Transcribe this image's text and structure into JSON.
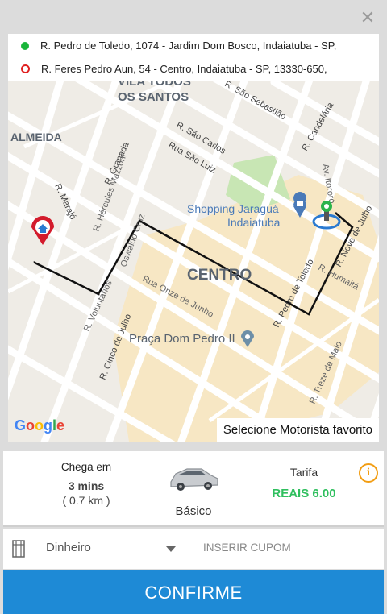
{
  "addresses": {
    "origin": "R. Pedro de Toledo, 1074 - Jardim Dom Bosco, Indaiatuba - SP,",
    "destination": "R. Feres Pedro Aun, 54 - Centro, Indaiatuba - SP, 13330-650,"
  },
  "map": {
    "labels": {
      "vila": "VILA TODOS",
      "santos": "OS SANTOS",
      "almeida": "ALMEIDA",
      "centro": "CENTRO",
      "shopping1": "Shopping Jaraguá",
      "shopping2": "Indaiatuba",
      "praca": "Praça Dom Pedro II",
      "r_sao_sebastiao": "R. São Sebastião",
      "r_candelaria": "R. Candelária",
      "r_sao_carlos": "R. São Carlos",
      "rua_sao_luiz": "Rua São Luiz",
      "r_granada": "R. Granada",
      "r_hercules": "R. Hércules Mazzoni",
      "r_marajo": "R. Marajó",
      "r_voluntarios": "R. Voluntários",
      "r_oswaldo": "Oswaldo Cruz",
      "rua_onze": "Rua Onze de Junho",
      "r_cinco": "R. Cinco de Julho",
      "r_pedro": "R. Pedro de Toledo",
      "r_humaita": "R. Humaitá",
      "r_nove": "R. Nove de Julho",
      "av_itororo": "Av. Itororó",
      "r_treze": "R. Treze de Maio"
    },
    "google": [
      "G",
      "o",
      "o",
      "g",
      "l",
      "e"
    ],
    "favorite_driver": "Selecione Motorista favorito"
  },
  "trip": {
    "arrival_label": "Chega em",
    "arrival_time": "3 mins",
    "distance": "( 0.7 km )",
    "category": "Básico",
    "fare_label": "Tarifa",
    "fare_value": "REAIS 6.00"
  },
  "payment": {
    "method": "Dinheiro",
    "coupon_placeholder": "INSERIR CUPOM"
  },
  "confirm_label": "CONFIRME",
  "colors": {
    "accent": "#1e8ad6",
    "price": "#2fbf5e",
    "origin_dot": "#19b53a",
    "destination_dot": "#e02020",
    "info": "#f29d12"
  },
  "icons": [
    "close-icon",
    "home-pin-icon",
    "user-pin-icon",
    "car-icon",
    "info-icon",
    "cash-icon",
    "chevron-down-icon",
    "shopping-pin-icon",
    "place-pin-icon"
  ]
}
